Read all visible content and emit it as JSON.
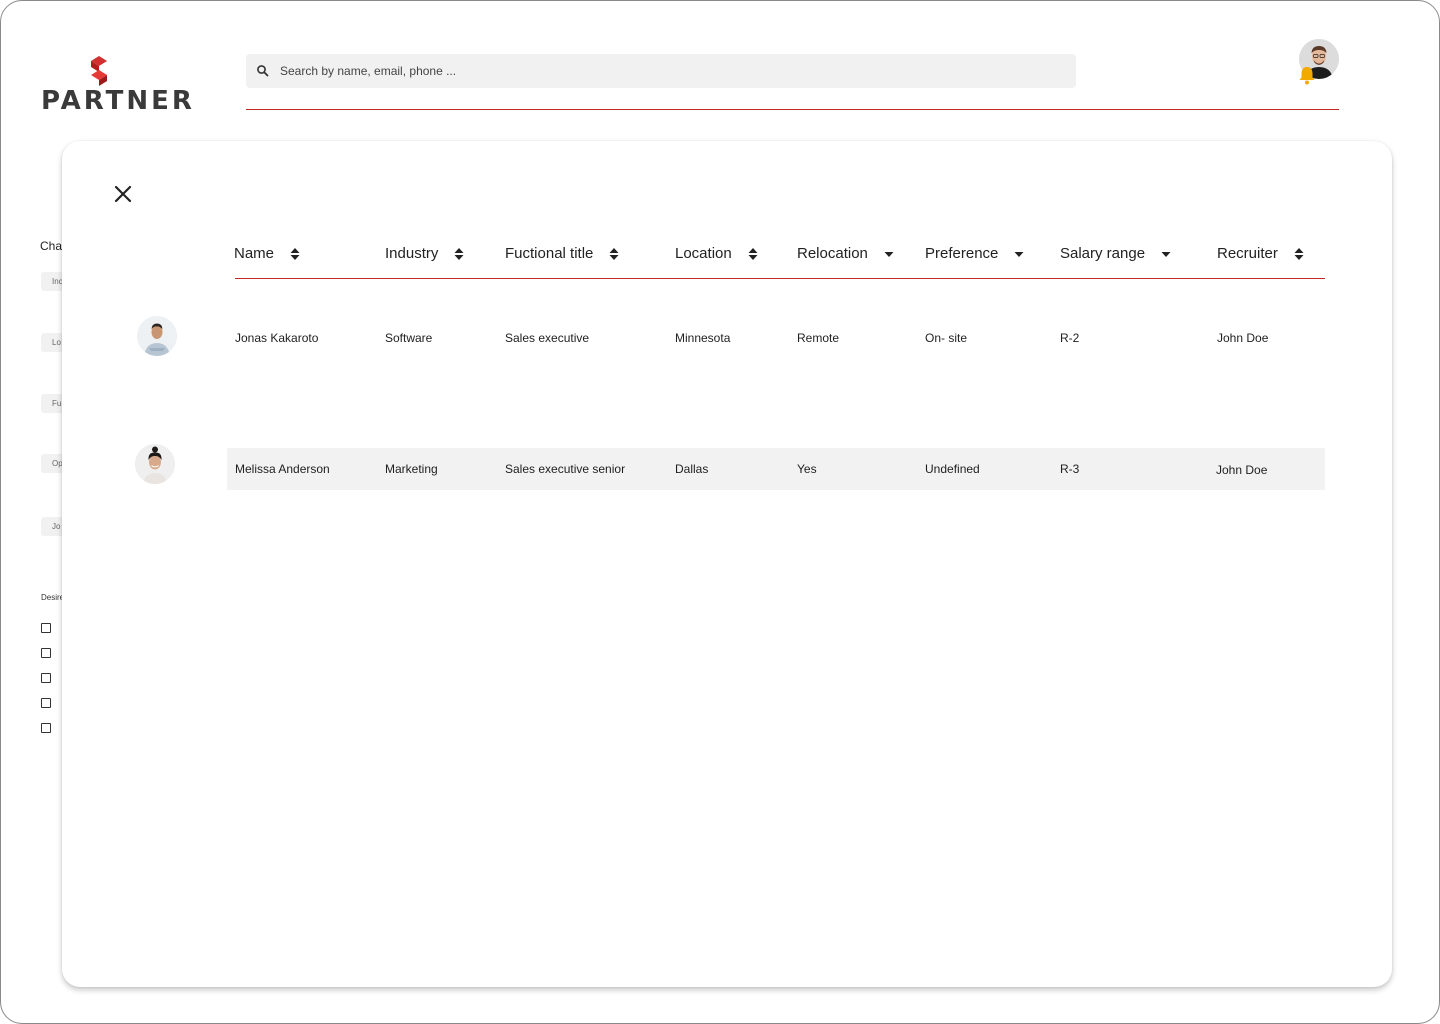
{
  "brand": {
    "name": "PARTNER"
  },
  "search": {
    "placeholder": "Search by name, email, phone ..."
  },
  "filters": {
    "title": "Cha",
    "pills": [
      "Inc",
      "Lo",
      "Fu",
      "Op",
      "Jo"
    ],
    "desired_label": "Desire",
    "checkbox_count": 5
  },
  "table": {
    "columns": [
      {
        "label": "Name",
        "sort": "both"
      },
      {
        "label": "Industry",
        "sort": "both"
      },
      {
        "label": "Fuctional title",
        "sort": "both"
      },
      {
        "label": "Location",
        "sort": "both"
      },
      {
        "label": "Relocation",
        "sort": "down"
      },
      {
        "label": "Preference",
        "sort": "down"
      },
      {
        "label": "Salary range",
        "sort": "down"
      },
      {
        "label": "Recruiter",
        "sort": "both"
      }
    ],
    "rows": [
      {
        "name": "Jonas Kakaroto",
        "industry": "Software",
        "title": "Sales executive",
        "location": "Minnesota",
        "relocation": "Remote",
        "preference": "On- site",
        "salary": "R-2",
        "recruiter": "John Doe"
      },
      {
        "name": "Melissa Anderson",
        "industry": "Marketing",
        "title": "Sales executive senior",
        "location": "Dallas",
        "relocation": "Yes",
        "preference": "Undefined",
        "salary": "R-3",
        "recruiter": "John Doe"
      }
    ]
  },
  "colors": {
    "accent": "#c62828",
    "notification": "#f2a900"
  },
  "icons": {
    "close": "close-icon",
    "search": "search-icon",
    "bell": "bell-icon",
    "sort": "sort-icon"
  }
}
